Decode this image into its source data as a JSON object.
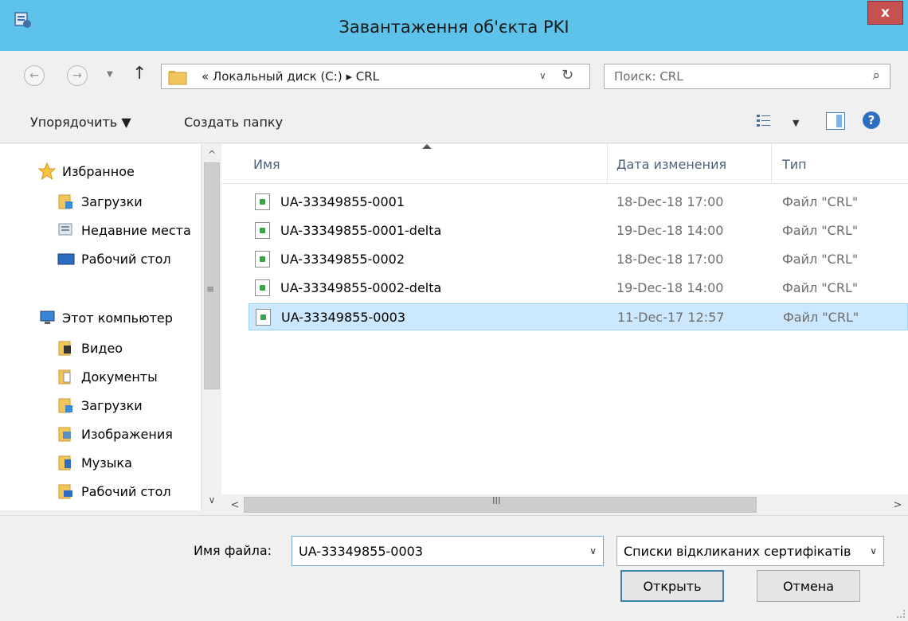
{
  "window": {
    "title": "Завантаження об'єкта PKI",
    "close_label": "x"
  },
  "nav": {
    "back_label": "←",
    "forward_label": "→",
    "dropdown_label": "▼",
    "up_label": "↑",
    "address_path": "«  Локальный диск (C:)  ▸  CRL",
    "address_dropdown": "∨",
    "refresh_label": "↻",
    "search_placeholder": "Поиск: CRL",
    "search_icon": "⌕"
  },
  "toolbar": {
    "organize_label": "Упорядочить ▼",
    "new_folder_label": "Создать папку",
    "view_dropdown": "▼",
    "help_label": "?"
  },
  "sidebar": {
    "items": [
      {
        "label": "Избранное",
        "icon": "star-icon"
      },
      {
        "label": "Загрузки",
        "icon": "downloads-folder-icon"
      },
      {
        "label": "Недавние места",
        "icon": "recent-places-icon"
      },
      {
        "label": "Рабочий стол",
        "icon": "desktop-icon"
      },
      {
        "label": "Этот компьютер",
        "icon": "computer-icon"
      },
      {
        "label": "Видео",
        "icon": "video-folder-icon"
      },
      {
        "label": "Документы",
        "icon": "documents-folder-icon"
      },
      {
        "label": "Загрузки",
        "icon": "downloads-folder-icon"
      },
      {
        "label": "Изображения",
        "icon": "pictures-folder-icon"
      },
      {
        "label": "Музыка",
        "icon": "music-folder-icon"
      },
      {
        "label": "Рабочий стол",
        "icon": "desktop-folder-icon"
      }
    ]
  },
  "scroll": {
    "up": "^",
    "down": "∨",
    "grip": "≡",
    "left": "<",
    "right": ">",
    "hgrip": "III"
  },
  "filelist": {
    "columns": [
      "Имя",
      "Дата изменения",
      "Тип"
    ],
    "rows": [
      {
        "name": "UA-33349855-0001",
        "date": "18-Dec-18 17:00",
        "type": "Файл \"CRL\"",
        "selected": false
      },
      {
        "name": "UA-33349855-0001-delta",
        "date": "19-Dec-18 14:00",
        "type": "Файл \"CRL\"",
        "selected": false
      },
      {
        "name": "UA-33349855-0002",
        "date": "18-Dec-18 17:00",
        "type": "Файл \"CRL\"",
        "selected": false
      },
      {
        "name": "UA-33349855-0002-delta",
        "date": "19-Dec-18 14:00",
        "type": "Файл \"CRL\"",
        "selected": false
      },
      {
        "name": "UA-33349855-0003",
        "date": "11-Dec-17 12:57",
        "type": "Файл \"CRL\"",
        "selected": true
      }
    ]
  },
  "bottom": {
    "filename_label": "Имя файла:",
    "filename_value": "UA-33349855-0003",
    "filename_dropdown": "∨",
    "filter_value": "Списки відкликаних сертифікатів",
    "filter_dropdown": "∨",
    "open_label": "Открыть",
    "cancel_label": "Отмена"
  },
  "colors": {
    "titlebar": "#5ec3ea",
    "close": "#c75050",
    "selection": "#cce8ff"
  }
}
